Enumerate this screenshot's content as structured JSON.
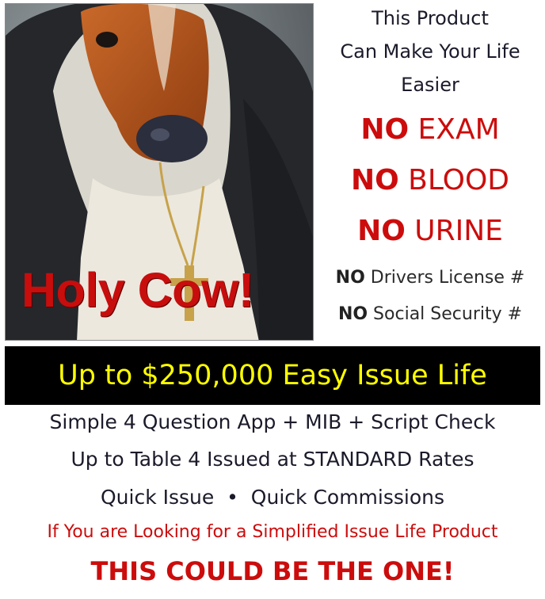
{
  "photo": {
    "overlay_text": "Holy Cow!"
  },
  "headline": {
    "line1": "This Product",
    "line2": "Can Make Your Life",
    "line3": "Easier"
  },
  "no_items_large": [
    {
      "bold": "NO",
      "text": " EXAM"
    },
    {
      "bold": "NO",
      "text": " BLOOD"
    },
    {
      "bold": "NO",
      "text": " URINE"
    }
  ],
  "no_items_small": [
    {
      "bold": "NO",
      "text": " Drivers License #"
    },
    {
      "bold": "NO",
      "text": " Social Security #"
    }
  ],
  "banner": {
    "text": "Up to $250,000 Easy Issue Life"
  },
  "details": {
    "line1": "Simple 4 Question App + MIB + Script Check",
    "line2": "Up to Table 4 Issued at STANDARD Rates",
    "line3": "Quick Issue  •  Quick Commissions"
  },
  "cta": {
    "looking": "If You are Looking for a Simplified Issue Life Product",
    "one": "THIS COULD BE THE ONE!"
  },
  "colors": {
    "red": "#cc0c0c",
    "banner_bg": "#000000",
    "banner_text": "#ffff00"
  }
}
